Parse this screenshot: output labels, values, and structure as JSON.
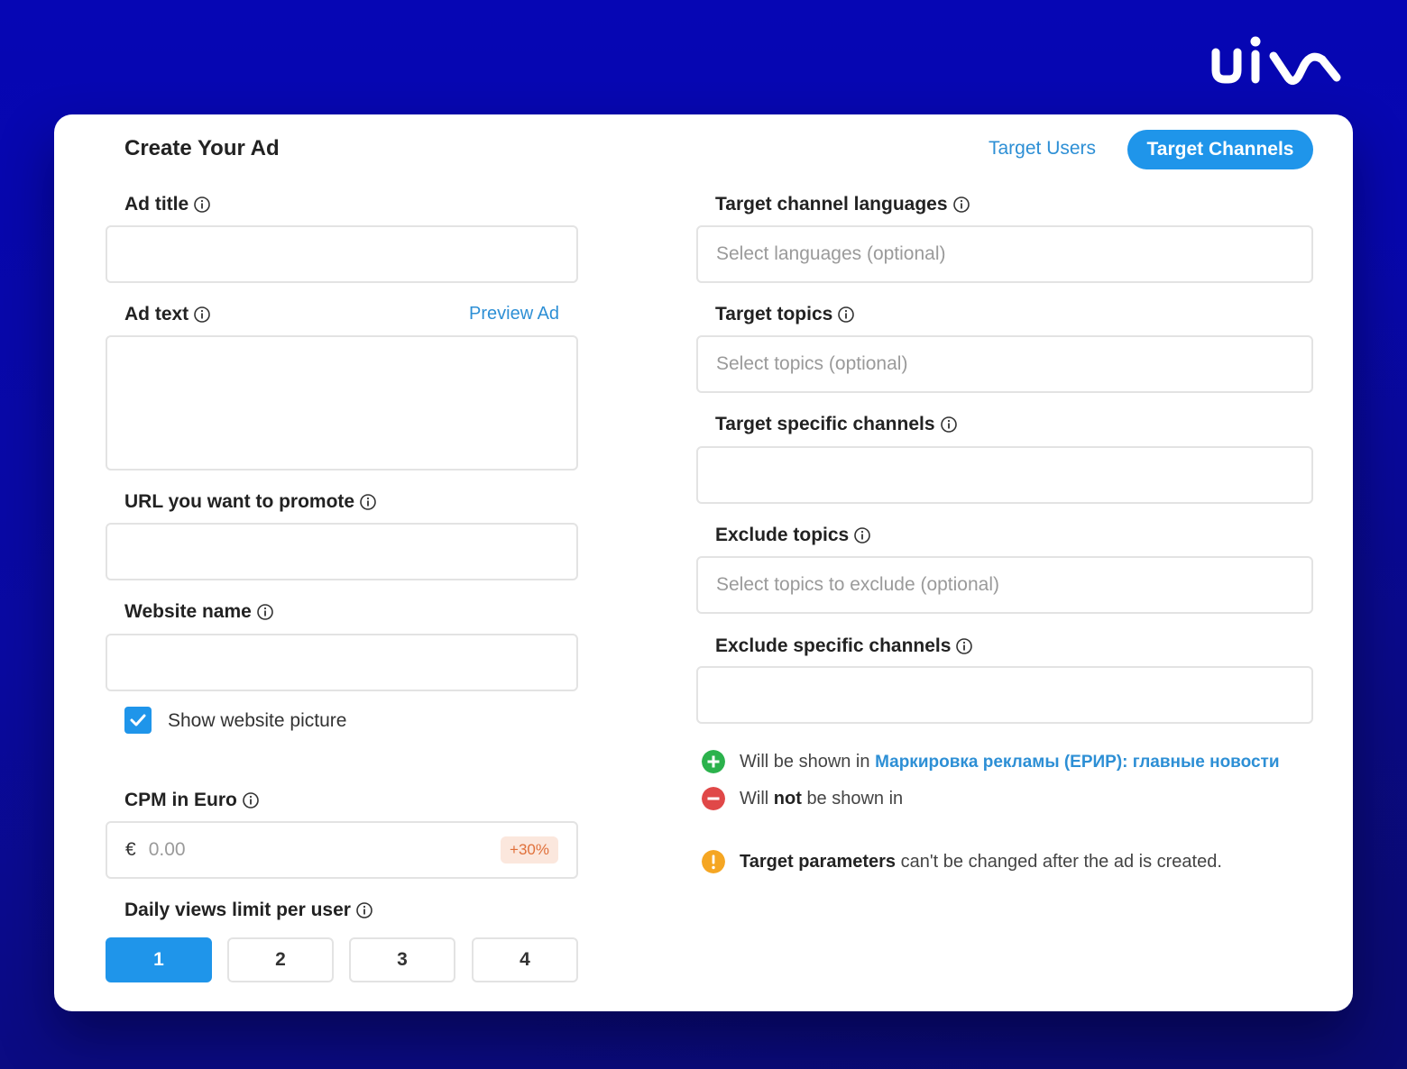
{
  "header": {
    "title": "Create Your Ad",
    "tabs": [
      {
        "label": "Target Users",
        "active": false
      },
      {
        "label": "Target Channels",
        "active": true
      }
    ]
  },
  "left": {
    "ad_title": {
      "label": "Ad title",
      "value": ""
    },
    "ad_text": {
      "label": "Ad text",
      "value": "",
      "preview_label": "Preview Ad"
    },
    "url": {
      "label": "URL you want to promote",
      "value": ""
    },
    "website_name": {
      "label": "Website name",
      "value": ""
    },
    "show_picture": {
      "label": "Show website picture",
      "checked": true
    },
    "cpm": {
      "label": "CPM in Euro",
      "currency": "€",
      "placeholder": "0.00",
      "badge": "+30%"
    },
    "daily_views": {
      "label": "Daily views limit per user",
      "options": [
        "1",
        "2",
        "3",
        "4"
      ],
      "selected": "1"
    }
  },
  "right": {
    "languages": {
      "label": "Target channel languages",
      "placeholder": "Select languages (optional)"
    },
    "topics": {
      "label": "Target topics",
      "placeholder": "Select topics (optional)"
    },
    "specific_channels": {
      "label": "Target specific channels",
      "value": ""
    },
    "exclude_topics": {
      "label": "Exclude topics",
      "placeholder": "Select topics to exclude (optional)"
    },
    "exclude_channels": {
      "label": "Exclude specific channels",
      "value": ""
    },
    "shown_in": {
      "prefix": "Will be shown in",
      "channel": "Маркировка рекламы (ЕРИР): главные новости"
    },
    "not_shown_in": {
      "prefix_start": "Will",
      "emphasis": "not",
      "prefix_end": "be shown in"
    },
    "warning": {
      "emphasis": "Target parameters",
      "text": "can't be changed after the ad is created."
    }
  },
  "colors": {
    "background": "#0505b0",
    "accent": "#1f95ea",
    "link": "#2d8fd5",
    "success": "#2bb24c",
    "danger": "#e04848",
    "warning": "#f5a623",
    "badge_bg": "#fbe7dd",
    "badge_text": "#e0703a"
  }
}
